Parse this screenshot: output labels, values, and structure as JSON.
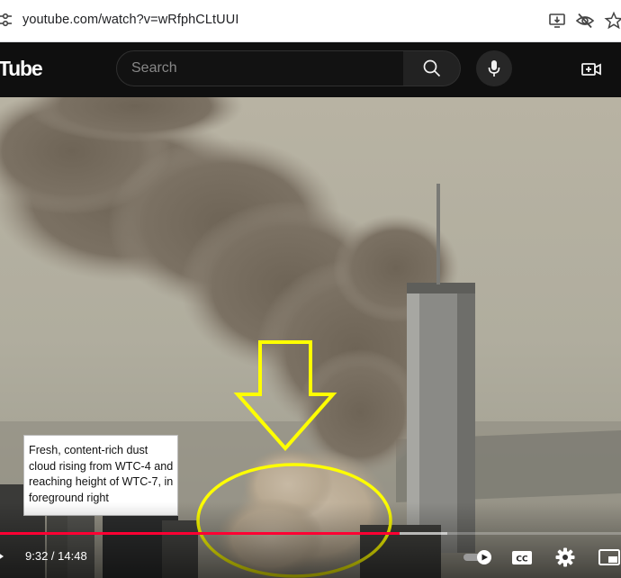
{
  "browser": {
    "url": "youtube.com/watch?v=wRfphCLtUUI",
    "icons": [
      "site-settings-icon",
      "install-app-icon",
      "eye-off-icon",
      "bookmark-star-icon"
    ]
  },
  "header": {
    "logo_text": "Tube",
    "search_placeholder": "Search",
    "icons": [
      "search-icon",
      "microphone-icon",
      "create-video-icon"
    ],
    "colors": {
      "background": "#0f0f0f",
      "search_border": "#303030",
      "search_button": "#222222"
    }
  },
  "video": {
    "annotation_text": "Fresh, content-rich dust cloud rising from WTC-4 and reaching height of WTC-7, in foreground right",
    "overlay_marks": [
      "yellow-arrow-down",
      "yellow-ellipse"
    ],
    "overlay_color": "#ffff00",
    "player": {
      "time": "9:32 / 14:48",
      "progress_fraction": 0.644,
      "buffered_fraction": 0.72,
      "progress_color": "#ff0033",
      "icons": [
        "autoplay-toggle-icon",
        "captions-icon",
        "settings-gear-icon",
        "miniplayer-icon"
      ]
    }
  }
}
